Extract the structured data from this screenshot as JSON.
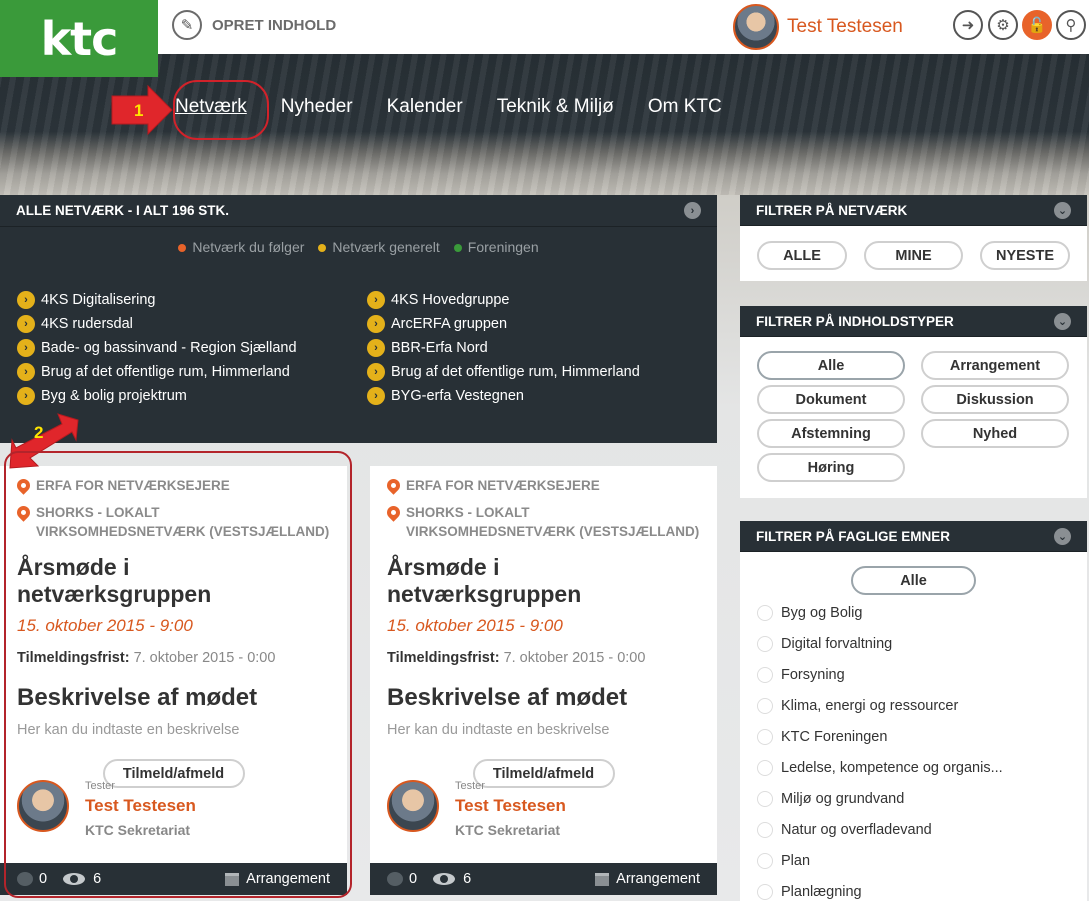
{
  "header": {
    "logo_text": "ktc",
    "create_label": "OPRET INDHOLD",
    "user_name": "Test Testesen"
  },
  "nav": {
    "items": [
      "Netværk",
      "Nyheder",
      "Kalender",
      "Teknik & Miljø",
      "Om KTC"
    ],
    "active_index": 0
  },
  "annotations": {
    "marker1": "1",
    "marker2": "2"
  },
  "networks": {
    "title": "ALLE NETVÆRK - I ALT 196 STK.",
    "legend": [
      {
        "label": "Netværk du følger",
        "color": "#e8632a"
      },
      {
        "label": "Netværk generelt",
        "color": "#e4b11a"
      },
      {
        "label": "Foreningen",
        "color": "#3a9a3a"
      }
    ],
    "left": [
      "4KS Digitalisering",
      "4KS rudersdal",
      "Bade- og bassinvand - Region Sjælland",
      "Brug af det offentlige rum, Himmerland",
      "Byg & bolig projektrum"
    ],
    "right": [
      "4KS Hovedgruppe",
      "ArcERFA gruppen",
      "BBR-Erfa Nord",
      "Brug af det offentlige rum, Himmerland",
      "BYG-erfa Vestegnen"
    ]
  },
  "cards": [
    {
      "cat1": "ERFA FOR NETVÆRKSEJERE",
      "cat2": "SHORKS - LOKALT VIRKSOMHEDSNETVÆRK (VESTSJÆLLAND)",
      "title": "Årsmøde i netværksgruppen",
      "date": "15. oktober 2015 - 9:00",
      "deadline_label": "Tilmeldingsfrist:",
      "deadline": "7. oktober 2015 - 0:00",
      "desc_head": "Beskrivelse af mødet",
      "desc": "Her kan du indtaste en beskrivelse",
      "button": "Tilmeld/afmeld",
      "role": "Tester",
      "author": "Test Testesen",
      "org": "KTC Sekretariat",
      "comments": "0",
      "views": "6",
      "type": "Arrangement"
    },
    {
      "cat1": "ERFA FOR NETVÆRKSEJERE",
      "cat2": "SHORKS - LOKALT VIRKSOMHEDSNETVÆRK (VESTSJÆLLAND)",
      "title": "Årsmøde i netværksgruppen",
      "date": "15. oktober 2015 - 9:00",
      "deadline_label": "Tilmeldingsfrist:",
      "deadline": "7. oktober 2015 - 0:00",
      "desc_head": "Beskrivelse af mødet",
      "desc": "Her kan du indtaste en beskrivelse",
      "button": "Tilmeld/afmeld",
      "role": "Tester",
      "author": "Test Testesen",
      "org": "KTC Sekretariat",
      "comments": "0",
      "views": "6",
      "type": "Arrangement"
    }
  ],
  "filter_network": {
    "title": "FILTRER PÅ NETVÆRK",
    "buttons": [
      "ALLE",
      "MINE",
      "NYESTE"
    ]
  },
  "filter_types": {
    "title": "FILTRER PÅ INDHOLDSTYPER",
    "buttons": [
      "Alle",
      "Arrangement",
      "Dokument",
      "Diskussion",
      "Afstemning",
      "Nyhed",
      "Høring"
    ]
  },
  "filter_topics": {
    "title": "FILTRER PÅ FAGLIGE EMNER",
    "all_label": "Alle",
    "topics": [
      "Byg og Bolig",
      "Digital forvaltning",
      "Forsyning",
      "Klima, energi og ressourcer",
      "KTC Foreningen",
      "Ledelse, kompetence og organis...",
      "Miljø og grundvand",
      "Natur og overfladevand",
      "Plan",
      "Planlægning"
    ]
  },
  "colors": {
    "accent": "#d8581f",
    "dark": "#283036",
    "brand_green": "#3a9a3a",
    "annotation_red": "#d2222a"
  }
}
